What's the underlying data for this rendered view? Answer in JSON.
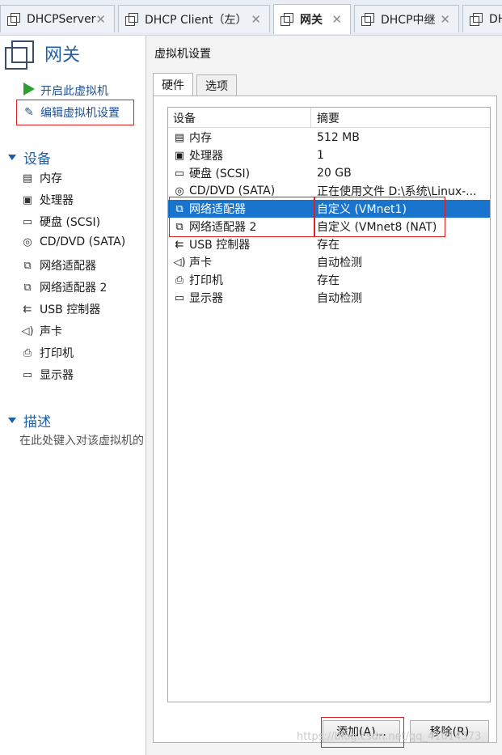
{
  "tabs": [
    {
      "label": "DHCPServer",
      "active": false
    },
    {
      "label": "DHCP Client（左）",
      "active": false
    },
    {
      "label": "网关",
      "active": true
    },
    {
      "label": "DHCP中继",
      "active": false
    },
    {
      "label": "DH",
      "active": false
    }
  ],
  "left_panel": {
    "vm_title": "网关",
    "actions": {
      "power_on": "开启此虚拟机",
      "edit_settings": "编辑虚拟机设置"
    },
    "devices_header": "设备",
    "devices": [
      {
        "icon": "memory-icon",
        "label": "内存"
      },
      {
        "icon": "processor-icon",
        "label": "处理器"
      },
      {
        "icon": "harddisk-icon",
        "label": "硬盘 (SCSI)"
      },
      {
        "icon": "cdrom-icon",
        "label": "CD/DVD (SATA)"
      },
      {
        "icon": "network-adapter-icon",
        "label": "网络适配器"
      },
      {
        "icon": "network-adapter-icon",
        "label": "网络适配器 2"
      },
      {
        "icon": "usb-icon",
        "label": "USB 控制器"
      },
      {
        "icon": "sound-icon",
        "label": "声卡"
      },
      {
        "icon": "printer-icon",
        "label": "打印机"
      },
      {
        "icon": "display-icon",
        "label": "显示器"
      }
    ],
    "description_header": "描述",
    "description_placeholder": "在此处键入对该虚拟机的"
  },
  "dialog": {
    "title": "虚拟机设置",
    "tabs": [
      "硬件",
      "选项"
    ],
    "list_headers": {
      "device": "设备",
      "summary": "摘要"
    },
    "rows": [
      {
        "icon": "memory-icon",
        "device": "内存",
        "summary": "512 MB"
      },
      {
        "icon": "processor-icon",
        "device": "处理器",
        "summary": "1"
      },
      {
        "icon": "harddisk-icon",
        "device": "硬盘 (SCSI)",
        "summary": "20 GB"
      },
      {
        "icon": "cdrom-icon",
        "device": "CD/DVD (SATA)",
        "summary": "正在使用文件 D:\\系统\\Linux-..."
      },
      {
        "icon": "network-adapter-icon",
        "device": "网络适配器",
        "summary": "自定义 (VMnet1)",
        "selected": true
      },
      {
        "icon": "network-adapter-icon",
        "device": "网络适配器 2",
        "summary": "自定义 (VMnet8 (NAT)"
      },
      {
        "icon": "usb-icon",
        "device": "USB 控制器",
        "summary": "存在"
      },
      {
        "icon": "sound-icon",
        "device": "声卡",
        "summary": "自动检测"
      },
      {
        "icon": "printer-icon",
        "device": "打印机",
        "summary": "存在"
      },
      {
        "icon": "display-icon",
        "device": "显示器",
        "summary": "自动检测"
      }
    ],
    "buttons": {
      "add": "添加(A)...",
      "remove": "移除(R)"
    }
  },
  "watermark": "https://blog.csdn.net/qq_41014373",
  "colors": {
    "accent": "#1d5fa8",
    "selection": "#1874cd",
    "highlight_box": "#e02020",
    "play_green": "#2e9e2e"
  }
}
